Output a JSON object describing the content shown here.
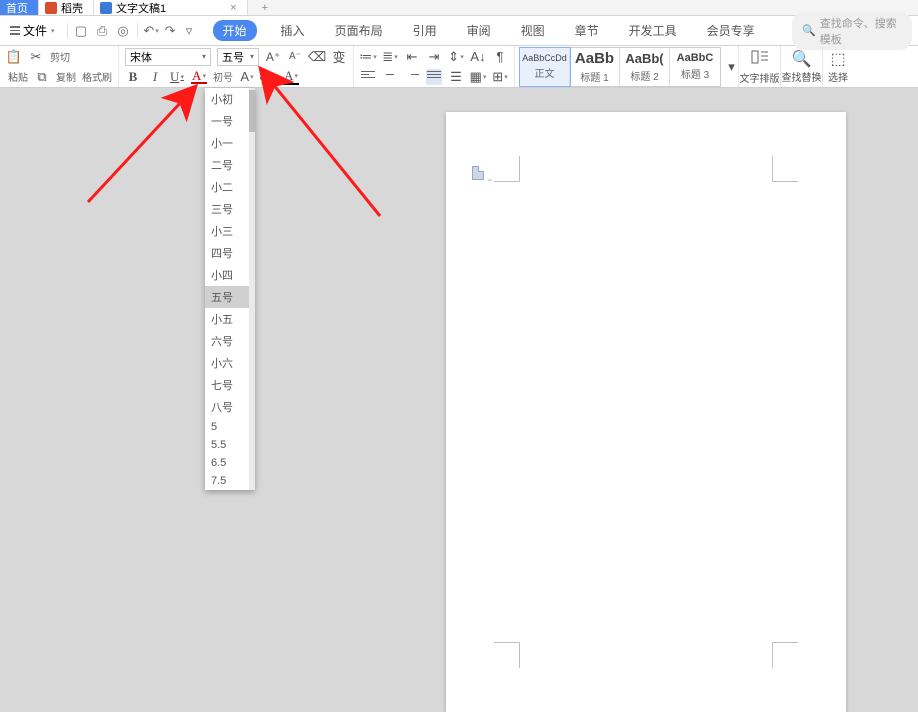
{
  "tabs": {
    "home": "首页",
    "orange": "稻壳",
    "doc": "文字文稿1",
    "close": "×",
    "plus": "+"
  },
  "menu": {
    "file": "文件",
    "search_placeholder": "查找命令、搜索模板",
    "ribbon": [
      "开始",
      "插入",
      "页面布局",
      "引用",
      "审阅",
      "视图",
      "章节",
      "开发工具",
      "会员专享"
    ]
  },
  "clipboard": {
    "cut": "剪切",
    "copy": "复制",
    "paste": "粘贴",
    "format_painter": "格式刷"
  },
  "font": {
    "name": "宋体",
    "size": "五号",
    "dropdown_first": "初号",
    "sizes": [
      "小初",
      "一号",
      "小一",
      "二号",
      "小二",
      "三号",
      "小三",
      "四号",
      "小四",
      "五号",
      "小五",
      "六号",
      "小六",
      "七号",
      "八号",
      "5",
      "5.5",
      "6.5",
      "7.5"
    ]
  },
  "styles": [
    {
      "preview": "AaBbCcDd",
      "label": "正文"
    },
    {
      "preview": "AaBb",
      "label": "标题 1"
    },
    {
      "preview": "AaBb(",
      "label": "标题 2"
    },
    {
      "preview": "AaBbC",
      "label": "标题 3"
    }
  ],
  "right_buttons": {
    "text_layout": "文字排版",
    "find_replace": "查找替换",
    "select": "选择"
  },
  "page": {
    "dash": "-"
  }
}
